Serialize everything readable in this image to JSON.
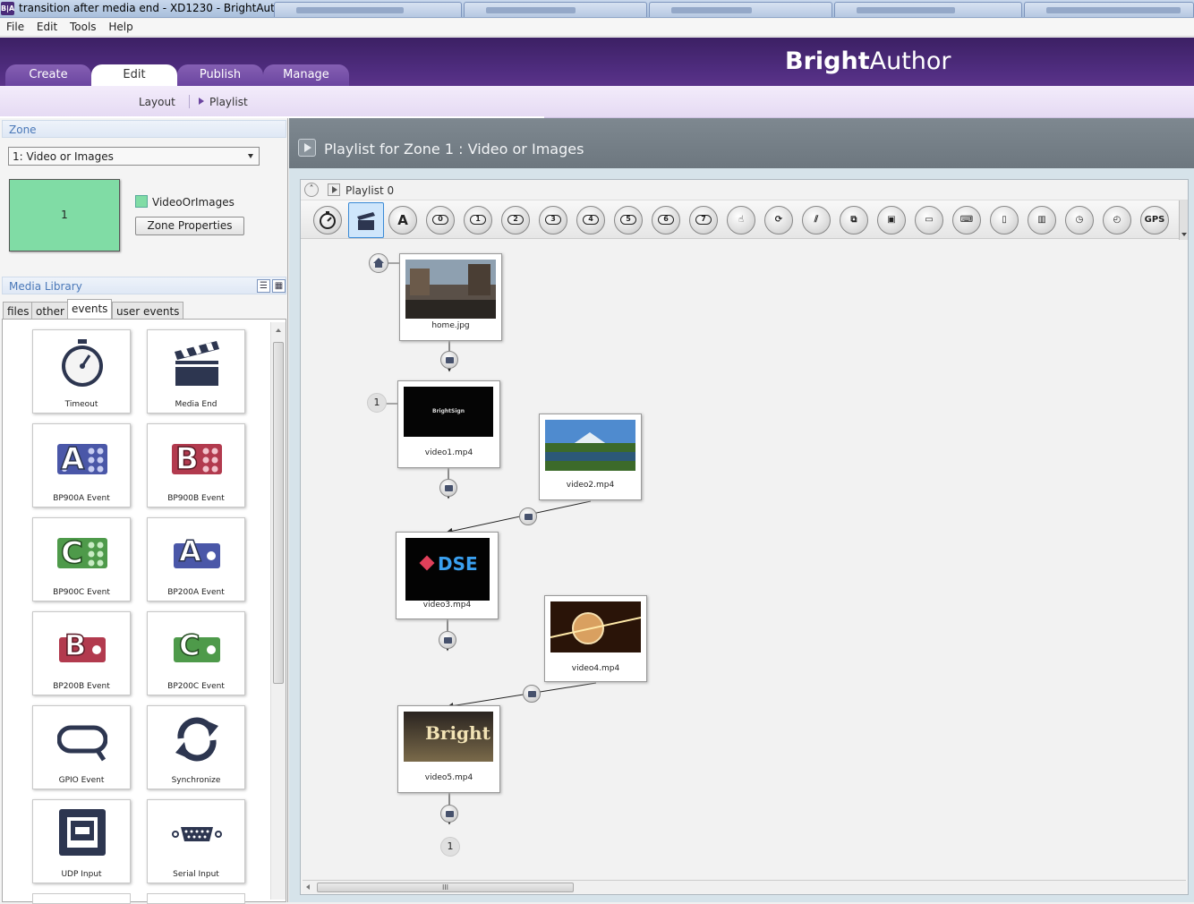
{
  "window": {
    "title": "transition after media end - XD1230 - BrightAuthor",
    "app_icon": "B|A"
  },
  "menu": [
    "File",
    "Edit",
    "Tools",
    "Help"
  ],
  "header": {
    "brand_bold": "Bright",
    "brand_rest": "Author",
    "tabs": [
      "Create",
      "Edit",
      "Publish",
      "Manage"
    ],
    "active_tab": "Edit"
  },
  "subnav": {
    "layout": "Layout",
    "playlist": "Playlist"
  },
  "zone": {
    "section_title": "Zone",
    "selected": "1: Video or Images",
    "thumb_number": "1",
    "name": "VideoOrImages",
    "properties_button": "Zone Properties",
    "color": "#80dca5"
  },
  "media_library": {
    "section_title": "Media Library",
    "tabs": [
      "files",
      "other",
      "events",
      "user events"
    ],
    "active_tab": "events",
    "tiles": [
      {
        "label": "Timeout",
        "icon": "stopwatch-icon"
      },
      {
        "label": "Media End",
        "icon": "clapperboard-icon"
      },
      {
        "label": "BP900A Event",
        "icon": "bp900a-icon"
      },
      {
        "label": "BP900B Event",
        "icon": "bp900b-icon"
      },
      {
        "label": "BP900C Event",
        "icon": "bp900c-icon"
      },
      {
        "label": "BP200A Event",
        "icon": "bp200a-icon"
      },
      {
        "label": "BP200B Event",
        "icon": "bp200b-icon"
      },
      {
        "label": "BP200C Event",
        "icon": "bp200c-icon"
      },
      {
        "label": "GPIO Event",
        "icon": "gpio-icon"
      },
      {
        "label": "Synchronize",
        "icon": "sync-icon"
      },
      {
        "label": "UDP Input",
        "icon": "udp-icon"
      },
      {
        "label": "Serial Input",
        "icon": "serial-icon"
      }
    ]
  },
  "playlist": {
    "header_title": "Playlist for Zone 1 : Video or Images",
    "name": "Playlist 0",
    "toolbar_numbers": [
      "0",
      "1",
      "2",
      "3",
      "4",
      "5",
      "6",
      "7"
    ],
    "gps_label": "GPS",
    "nodes": [
      {
        "caption": "home.jpg"
      },
      {
        "caption": "video1.mp4"
      },
      {
        "caption": "video2.mp4"
      },
      {
        "caption": "video3.mp4"
      },
      {
        "caption": "video4.mp4"
      },
      {
        "caption": "video5.mp4"
      }
    ],
    "badges": {
      "node1_number": "1",
      "end_number": "1"
    },
    "thumbnail_text": {
      "video1": "BrightSign",
      "video3": "DSE",
      "video5": "Bright"
    }
  }
}
